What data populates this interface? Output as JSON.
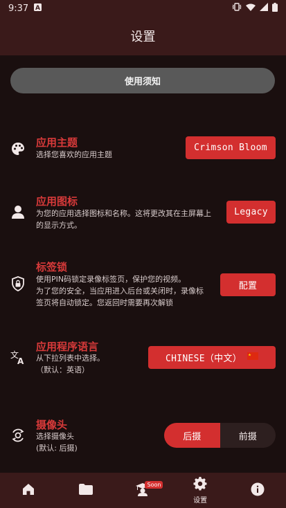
{
  "status_bar": {
    "time": "9:37"
  },
  "header": {
    "title": "设置"
  },
  "notice_button": {
    "label": "使用须知"
  },
  "theme": {
    "title": "应用主题",
    "description": "选择您喜欢的应用主题",
    "button_label": "Crimson Bloom"
  },
  "app_icon": {
    "title": "应用图标",
    "description_line1": "为您的应用选择图标和名称。这将更改其在主屏幕上",
    "description_line2": "的显示方式。",
    "button_label": "Legacy"
  },
  "tab_lock": {
    "title": "标签锁",
    "description_line1": "使用PIN码锁定录像标签页，保护您的视频。",
    "description_line2": "为了您的安全，当应用进入后台或关闭时，录像标",
    "description_line3": "签页将自动锁定。您返回时需要再次解锁",
    "button_label": "配置"
  },
  "language": {
    "title": "应用程序语言",
    "description_line1": "从下拉列表中选择。",
    "description_line2": "（默认：英语）",
    "button_label": "CHINESE（中文）",
    "flag": "🇨🇳"
  },
  "camera": {
    "title": "摄像头",
    "description_line1": "选择摄像头",
    "description_line2": "(默认: 后摄)",
    "options": [
      "后摄",
      "前摄"
    ],
    "selected": "后摄"
  },
  "bottom_nav": {
    "settings_label": "设置",
    "soon_badge": "Soon"
  },
  "colors": {
    "accent": "#d32f2f",
    "title_red": "#d83a3a",
    "bar": "#3a1a1a",
    "background": "#1a0f0f"
  }
}
